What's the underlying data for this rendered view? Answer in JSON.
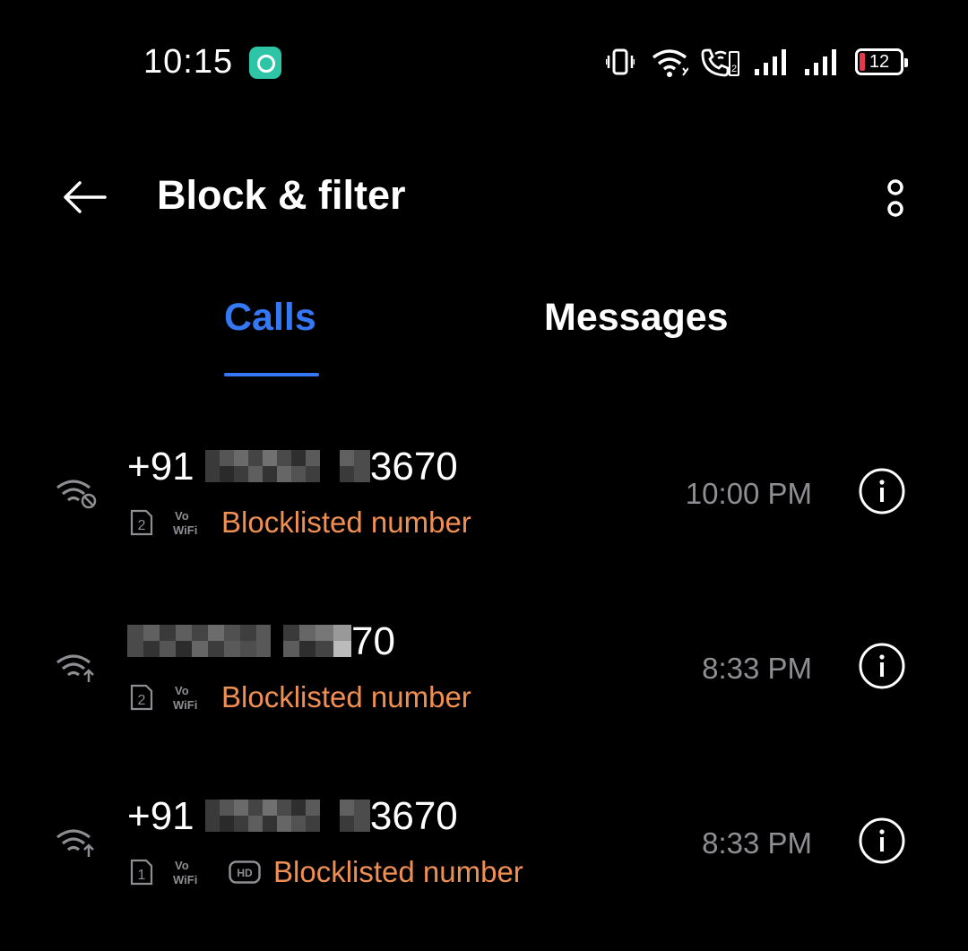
{
  "status_bar": {
    "time": "10:15",
    "app_notification_icon": "green-notification-app-icon",
    "icons": [
      "vibrate-icon",
      "wifi-icon",
      "wifi-calling-sim2-icon",
      "signal-sim1-icon",
      "signal-sim2-icon"
    ],
    "battery_level": "12",
    "battery_color": "#e5384a"
  },
  "app_bar": {
    "back_icon": "arrow-left-icon",
    "title": "Block & filter",
    "more_icon": "more-vertical-icon"
  },
  "tabs": [
    {
      "label": "Calls",
      "selected": true
    },
    {
      "label": "Messages",
      "selected": false
    }
  ],
  "colors": {
    "accent": "#3478f6",
    "blocked_text": "#ef8f53",
    "time_text": "#8e8e93",
    "background": "#000000"
  },
  "calls": [
    {
      "type_icon": "wifi-blocked-icon",
      "number_prefix": "+91",
      "number_suffix": "3670",
      "sim_icon": "sim-2-icon",
      "sim_number": "2",
      "vowifi_top": "Vo",
      "vowifi_bottom": "WiFi",
      "hd": false,
      "label": "Blocklisted number",
      "time": "10:00 PM",
      "info_icon": "info-icon"
    },
    {
      "type_icon": "wifi-outgoing-icon",
      "number_prefix": "",
      "number_suffix": "70",
      "sim_icon": "sim-2-icon",
      "sim_number": "2",
      "vowifi_top": "Vo",
      "vowifi_bottom": "WiFi",
      "hd": false,
      "label": "Blocklisted number",
      "time": "8:33 PM",
      "info_icon": "info-icon"
    },
    {
      "type_icon": "wifi-outgoing-icon",
      "number_prefix": "+91",
      "number_suffix": "3670",
      "sim_icon": "sim-1-icon",
      "sim_number": "1",
      "vowifi_top": "Vo",
      "vowifi_bottom": "WiFi",
      "hd": true,
      "hd_label": "HD",
      "label": "Blocklisted number",
      "time": "8:33 PM",
      "info_icon": "info-icon"
    }
  ]
}
